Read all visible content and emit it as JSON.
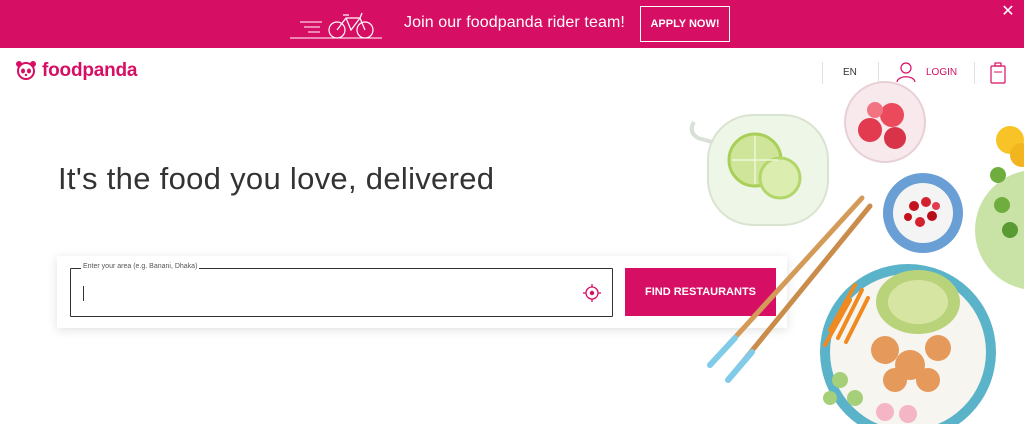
{
  "promo": {
    "text": "Join our foodpanda rider team!",
    "apply_label": "APPLY NOW!",
    "close_glyph": "✕",
    "icon": "bicycle-icon"
  },
  "header": {
    "brand": "foodpanda",
    "language": "EN",
    "login_label": "LOGIN",
    "icons": [
      "panda-logo-icon",
      "user-icon",
      "cart-icon"
    ]
  },
  "hero": {
    "title": "It's the food you love, delivered",
    "search": {
      "legend": "Enter your area (e.g. Banani, Dhaka)",
      "value": "",
      "locate_icon": "locate-target-icon"
    },
    "find_button_label": "FIND RESTAURANTS"
  },
  "colors": {
    "brand": "#d70f64",
    "text": "#333333",
    "background": "#ffffff"
  }
}
